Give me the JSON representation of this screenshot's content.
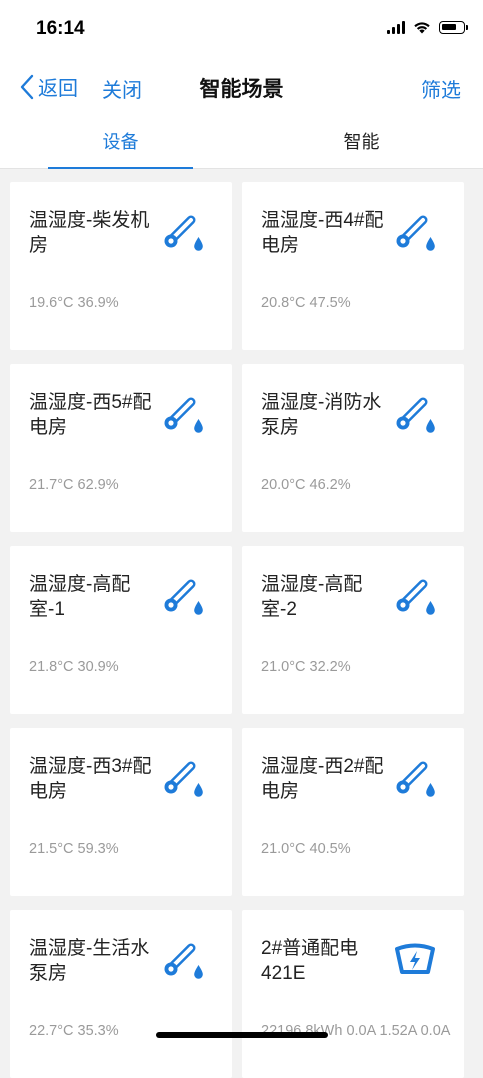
{
  "status": {
    "time": "16:14"
  },
  "nav": {
    "back_label": "返回",
    "close_label": "关闭",
    "title": "智能场景",
    "filter_label": "筛选"
  },
  "tabs": [
    {
      "label": "设备",
      "active": true
    },
    {
      "label": "智能",
      "active": false
    }
  ],
  "colors": {
    "accent": "#1e7bd9",
    "value_text": "#9a9a9a",
    "background": "#f2f2f2"
  },
  "devices": [
    {
      "name": "温湿度-柴发机房",
      "value": "19.6°C 36.9%",
      "icon": "thermo-humidity-icon"
    },
    {
      "name": "温湿度-西4#配电房",
      "value": "20.8°C 47.5%",
      "icon": "thermo-humidity-icon"
    },
    {
      "name": "温湿度-西5#配电房",
      "value": "21.7°C 62.9%",
      "icon": "thermo-humidity-icon"
    },
    {
      "name": "温湿度-消防水泵房",
      "value": "20.0°C 46.2%",
      "icon": "thermo-humidity-icon"
    },
    {
      "name": "温湿度-高配室-1",
      "value": "21.8°C 30.9%",
      "icon": "thermo-humidity-icon"
    },
    {
      "name": "温湿度-高配室-2",
      "value": "21.0°C 32.2%",
      "icon": "thermo-humidity-icon"
    },
    {
      "name": "温湿度-西3#配电房",
      "value": "21.5°C 59.3%",
      "icon": "thermo-humidity-icon"
    },
    {
      "name": "温湿度-西2#配电房",
      "value": "21.0°C 40.5%",
      "icon": "thermo-humidity-icon"
    },
    {
      "name": "温湿度-生活水泵房",
      "value": "22.7°C 35.3%",
      "icon": "thermo-humidity-icon"
    },
    {
      "name": "2#普通配电421E",
      "value": "22196.8kWh 0.0A 1.52A 0.0A",
      "icon": "power-meter-icon"
    }
  ]
}
